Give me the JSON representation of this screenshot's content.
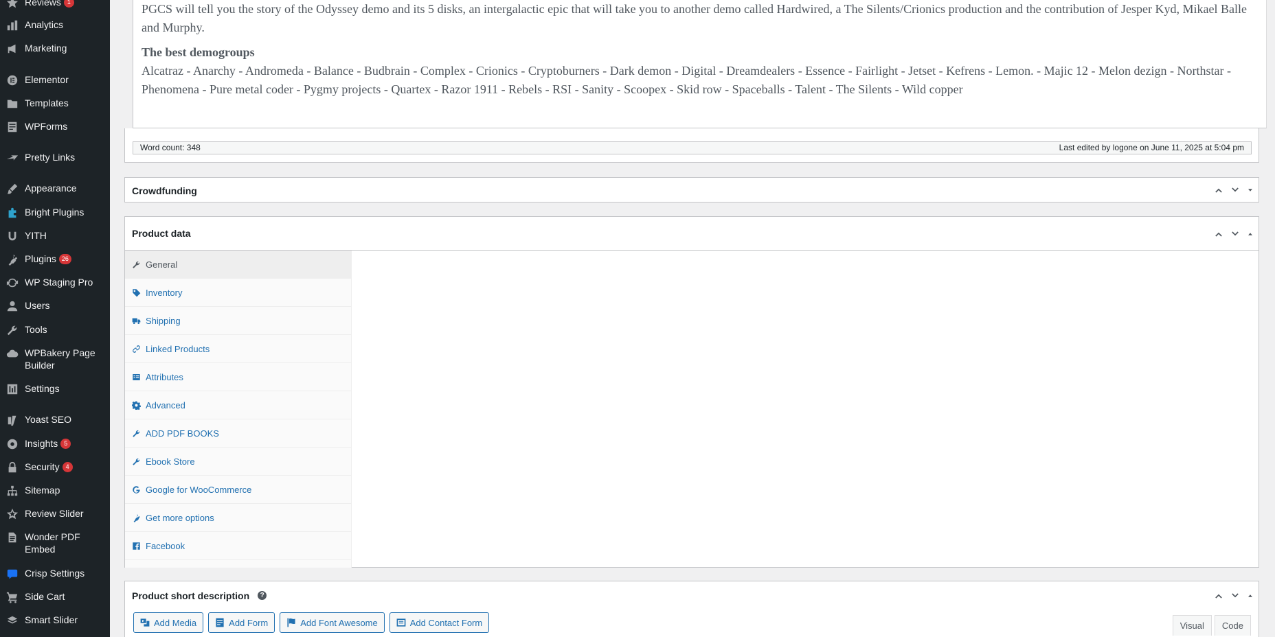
{
  "sidebar": {
    "items": [
      {
        "label": "Reviews",
        "icon": "star-icon",
        "badge": "1"
      },
      {
        "label": "Analytics",
        "icon": "bar-chart-icon",
        "badge": ""
      },
      {
        "label": "Marketing",
        "icon": "megaphone-icon",
        "badge": ""
      },
      {
        "label": "Elementor",
        "icon": "elementor-icon",
        "badge": ""
      },
      {
        "label": "Templates",
        "icon": "folder-icon",
        "badge": ""
      },
      {
        "label": "WPForms",
        "icon": "form-icon",
        "badge": ""
      },
      {
        "label": "Pretty Links",
        "icon": "star-link-icon",
        "badge": ""
      },
      {
        "label": "Appearance",
        "icon": "brush-icon",
        "badge": ""
      },
      {
        "label": "Bright Plugins",
        "icon": "puzzle-icon",
        "badge": ""
      },
      {
        "label": "YITH",
        "icon": "yith-icon",
        "badge": ""
      },
      {
        "label": "Plugins",
        "icon": "plug-icon",
        "badge": "26"
      },
      {
        "label": "WP Staging Pro",
        "icon": "sync-icon",
        "badge": ""
      },
      {
        "label": "Users",
        "icon": "user-icon",
        "badge": ""
      },
      {
        "label": "Tools",
        "icon": "wrench-icon",
        "badge": ""
      },
      {
        "label": "WPBakery Page Builder",
        "icon": "cloud-icon",
        "badge": ""
      },
      {
        "label": "Settings",
        "icon": "sliders-icon",
        "badge": ""
      },
      {
        "label": "Yoast SEO",
        "icon": "yoast-icon",
        "badge": ""
      },
      {
        "label": "Insights",
        "icon": "insights-icon",
        "badge": "5"
      },
      {
        "label": "Security",
        "icon": "lock-icon",
        "badge": "4"
      },
      {
        "label": "Sitemap",
        "icon": "sitemap-icon",
        "badge": ""
      },
      {
        "label": "Review Slider",
        "icon": "review-star-icon",
        "badge": ""
      },
      {
        "label": "Wonder PDF Embed",
        "icon": "document-icon",
        "badge": ""
      },
      {
        "label": "Crisp Settings",
        "icon": "chat-icon",
        "badge": ""
      },
      {
        "label": "Side Cart",
        "icon": "cart-icon",
        "badge": ""
      },
      {
        "label": "Smart Slider",
        "icon": "slider-icon",
        "badge": ""
      }
    ]
  },
  "editor": {
    "paragraph": "PGCS will tell you the story of the Odyssey demo and its 5 disks, an intergalactic epic that will take you to another demo called Hardwired, a The Silents/Crionics production and the contribution of Jesper Kyd, Mikael Balle and Murphy.",
    "heading": "The best demogroups",
    "groups": "Alcatraz - Anarchy - Andromeda - Balance - Budbrain - Complex - Crionics - Cryptoburners - Dark demon - Digital - Dreamdealers - Essence - Fairlight - Jetset - Kefrens - Lemon. - Majic 12 - Melon dezign - Northstar - Phenomena - Pure metal coder - Pygmy projects - Quartex - Razor 1911 - Rebels - RSI - Sanity - Scoopex - Skid row - Spaceballs - Talent - The Silents - Wild copper",
    "word_count": "Word count: 348",
    "last_edited": "Last edited by logone on June 11, 2025 at 5:04 pm"
  },
  "crowdfunding": {
    "title": "Crowdfunding"
  },
  "product_data": {
    "title": "Product data",
    "tabs": [
      {
        "label": "General",
        "icon": "wrench-icon",
        "active": true
      },
      {
        "label": "Inventory",
        "icon": "tag-icon",
        "active": false
      },
      {
        "label": "Shipping",
        "icon": "truck-icon",
        "active": false
      },
      {
        "label": "Linked Products",
        "icon": "link-icon",
        "active": false
      },
      {
        "label": "Attributes",
        "icon": "list-icon",
        "active": false
      },
      {
        "label": "Advanced",
        "icon": "gear-icon",
        "active": false
      },
      {
        "label": "ADD PDF BOOKS",
        "icon": "wrench-icon",
        "active": false
      },
      {
        "label": "Ebook Store",
        "icon": "wrench-icon",
        "active": false
      },
      {
        "label": "Google for WooCommerce",
        "icon": "google-icon",
        "active": false
      },
      {
        "label": "Get more options",
        "icon": "plug-icon",
        "active": false
      },
      {
        "label": "Facebook",
        "icon": "facebook-icon",
        "active": false
      }
    ]
  },
  "short_description": {
    "title": "Product short description",
    "help": "?",
    "buttons": [
      "Add Media",
      "Add Form",
      "Add Font Awesome",
      "Add Contact Form"
    ],
    "editor_tabs": [
      "Visual",
      "Code"
    ]
  }
}
